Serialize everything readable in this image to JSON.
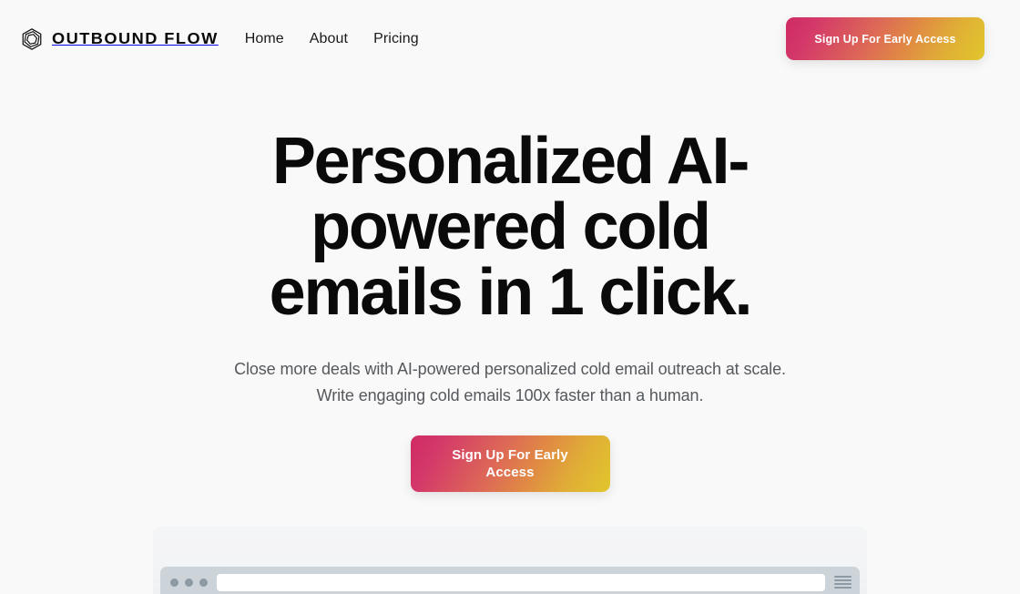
{
  "page": {
    "background_color": "#f9f9f9",
    "text_color": "#0a0a0a"
  },
  "header": {
    "brand": {
      "icon": "nested-hexagon-logo-icon",
      "wordmark": "OUTBOUND FLOW"
    },
    "nav": [
      {
        "label": "Home"
      },
      {
        "label": "About"
      },
      {
        "label": "Pricing"
      }
    ],
    "cta": {
      "label": "Sign Up For Early Access",
      "gradient_from": "#cf2a63",
      "gradient_to": "#e1c62c"
    }
  },
  "hero": {
    "title": "Personalized AI-powered cold emails in 1 click.",
    "subtitle": "Close more deals with AI-powered personalized cold email outreach at scale. Write engaging cold emails 100x faster than a human.",
    "cta": {
      "label": "Sign Up For Early Access",
      "gradient_from": "#cf2a63",
      "gradient_to": "#e1c62c"
    }
  },
  "mockup": {
    "chrome_color": "#ccd4d9",
    "dot_color": "#8d9aa3",
    "url_value": "",
    "menu_icon": "hamburger-menu-icon",
    "traffic_lights": [
      "dot-1",
      "dot-2",
      "dot-3"
    ]
  }
}
